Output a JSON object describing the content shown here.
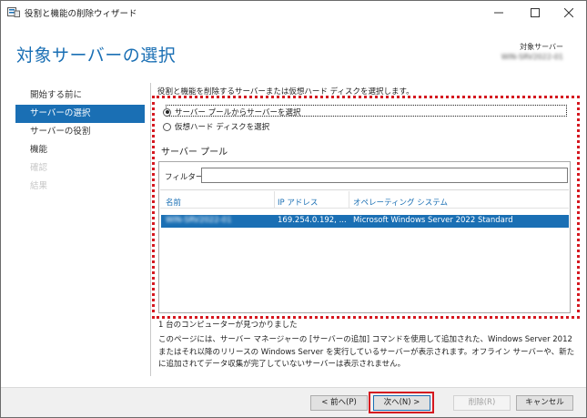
{
  "window": {
    "title": "役割と機能の削除ウィザード"
  },
  "header": {
    "page_title": "対象サーバーの選択",
    "target_label": "対象サーバー",
    "target_value": "WIN-SRV2022-01"
  },
  "nav": {
    "items": [
      {
        "label": "開始する前に",
        "state": "normal"
      },
      {
        "label": "サーバーの選択",
        "state": "active"
      },
      {
        "label": "サーバーの役割",
        "state": "normal"
      },
      {
        "label": "機能",
        "state": "normal"
      },
      {
        "label": "確認",
        "state": "disabled"
      },
      {
        "label": "結果",
        "state": "disabled"
      }
    ]
  },
  "main": {
    "instruction": "役割と機能を削除するサーバーまたは仮想ハード ディスクを選択します。",
    "options": [
      {
        "label": "サーバー プールからサーバーを選択",
        "checked": true
      },
      {
        "label": "仮想ハード ディスクを選択",
        "checked": false
      }
    ],
    "pool_label": "サーバー プール",
    "filter_label": "フィルター:",
    "filter_value": "",
    "columns": [
      "名前",
      "IP アドレス",
      "オペレーティング システム"
    ],
    "rows": [
      {
        "name": "WIN-SRV2022-01",
        "ip": "169.254.0.192, ...",
        "os": "Microsoft Windows Server 2022 Standard"
      }
    ],
    "found_text": "1 台のコンピューターが見つかりました",
    "description": "このページには、サーバー マネージャーの [サーバーの追加] コマンドを使用して追加された、Windows Server 2012 またはそれ以降のリリースの Windows Server を実行しているサーバーが表示されます。オフライン サーバーや、新たに追加されてデータ収集が完了していないサーバーは表示されません。"
  },
  "footer": {
    "back": "< 前へ(P)",
    "next": "次へ(N) >",
    "remove": "削除(R)",
    "cancel": "キャンセル"
  },
  "colors": {
    "accent": "#1a6fb4",
    "highlight_red": "#d51820"
  },
  "icons": {
    "app": "server-wizard-icon",
    "minimize": "minimize-icon",
    "maximize": "maximize-icon",
    "close": "close-icon"
  }
}
